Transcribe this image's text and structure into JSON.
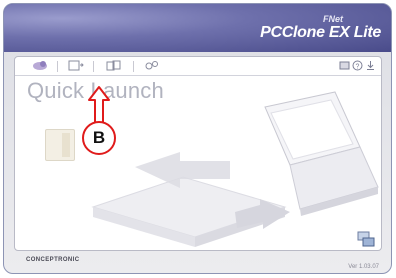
{
  "header": {
    "brand_small": "FNet",
    "brand_main": "PCClone EX Lite"
  },
  "toolbar": {
    "tabs": [
      {
        "icon": "quick-launch-icon",
        "active": true
      },
      {
        "icon": "backup-icon",
        "active": false
      },
      {
        "icon": "restore-icon",
        "active": false
      },
      {
        "icon": "settings-icon",
        "active": false
      }
    ],
    "tools": [
      "info-icon",
      "help-icon",
      "download-icon"
    ]
  },
  "main": {
    "title": "Quick Launch"
  },
  "annotation": {
    "label": "B",
    "color": "#e01b1b"
  },
  "footer": {
    "logo": "CONCEPTRONIC",
    "version": "Ver 1.03.07"
  },
  "colors": {
    "header": "#4c4f94",
    "title_text": "#b1b3bf"
  }
}
